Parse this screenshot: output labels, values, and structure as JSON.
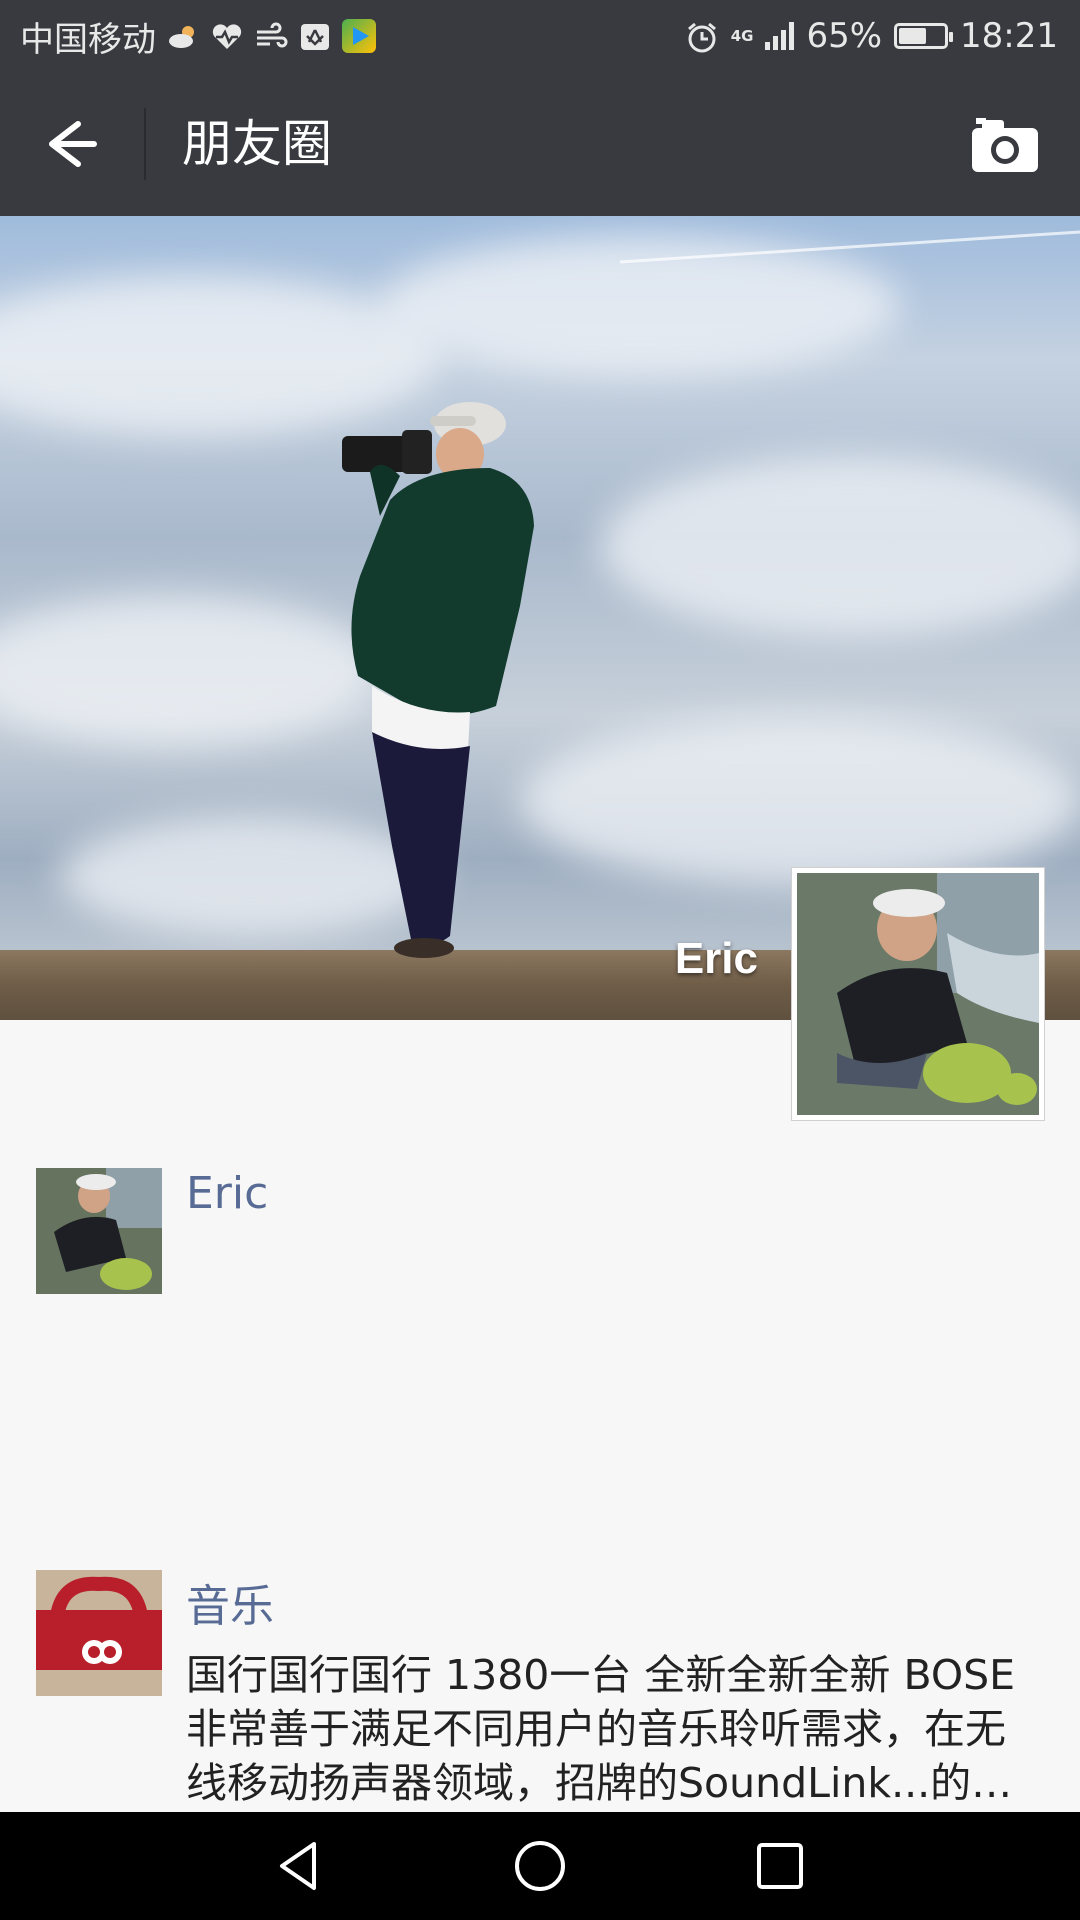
{
  "status_bar": {
    "carrier": "中国移动",
    "network": "4G",
    "battery_percent": "65%",
    "battery_level": 0.65,
    "time": "18:21",
    "icons": [
      "weather-icon",
      "heart-rate-icon",
      "wind-icon",
      "huawei-icon",
      "play-store-icon",
      "alarm-icon",
      "signal-icon",
      "battery-icon"
    ]
  },
  "header": {
    "title": "朋友圈",
    "back_icon": "back-arrow-icon",
    "camera_icon": "camera-icon"
  },
  "cover": {
    "user_name": "Eric"
  },
  "feed": [
    {
      "name": "Eric",
      "text": ""
    },
    {
      "name": "音乐",
      "text": "国行国行国行 1380一台 全新全新全新 BOSE非常善于满足不同用户的音乐聆听需求，在无线移动扬声器领域，招牌的SoundLink...的…"
    }
  ],
  "nav_bar": {
    "icons": [
      "nav-back-icon",
      "nav-home-icon",
      "nav-recents-icon"
    ]
  },
  "colors": {
    "bar_bg": "#393a3f",
    "link_name": "#576b95",
    "page_bg": "#f7f7f7"
  }
}
